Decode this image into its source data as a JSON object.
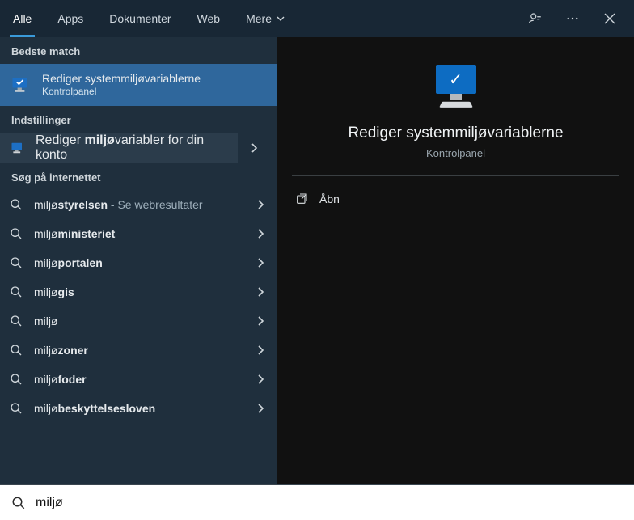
{
  "tabs": {
    "all": "Alle",
    "apps": "Apps",
    "documents": "Dokumenter",
    "web": "Web",
    "more": "Mere"
  },
  "sections": {
    "best_match": "Bedste match",
    "settings": "Indstillinger",
    "web": "Søg på internettet"
  },
  "best_match": {
    "title": "Rediger systemmiljøvariablerne",
    "subtitle": "Kontrolpanel"
  },
  "settings_item": {
    "prefix": "Rediger ",
    "bold": "miljø",
    "suffix": "variabler for din konto"
  },
  "web_results": [
    {
      "prefix": "miljø",
      "bold": "styrelsen",
      "extra": " - Se webresultater"
    },
    {
      "prefix": "miljø",
      "bold": "ministeriet",
      "extra": ""
    },
    {
      "prefix": "miljø",
      "bold": "portalen",
      "extra": ""
    },
    {
      "prefix": "miljø",
      "bold": "gis",
      "extra": ""
    },
    {
      "prefix": "miljø",
      "bold": "",
      "extra": ""
    },
    {
      "prefix": "miljø",
      "bold": "zoner",
      "extra": ""
    },
    {
      "prefix": "miljø",
      "bold": "foder",
      "extra": ""
    },
    {
      "prefix": "miljø",
      "bold": "beskyttelsesloven",
      "extra": ""
    }
  ],
  "preview": {
    "title": "Rediger systemmiljøvariablerne",
    "subtitle": "Kontrolpanel",
    "open": "Åbn"
  },
  "search": {
    "value": "miljø"
  }
}
